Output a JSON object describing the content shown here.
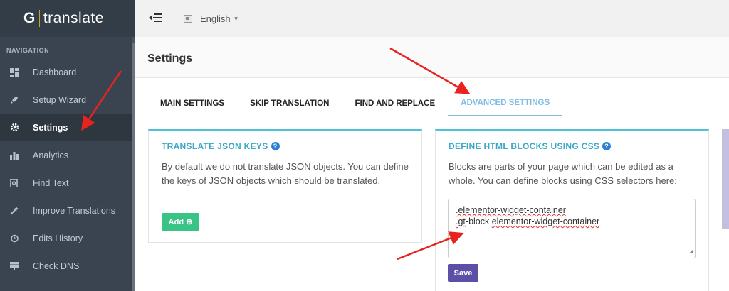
{
  "app": {
    "logo_letter": "G",
    "logo_name": "translate"
  },
  "sidebar": {
    "heading": "NAVIGATION",
    "items": [
      {
        "label": "Dashboard",
        "icon": "dashboard-icon"
      },
      {
        "label": "Setup Wizard",
        "icon": "rocket-icon"
      },
      {
        "label": "Settings",
        "icon": "gear-icon",
        "active": true
      },
      {
        "label": "Analytics",
        "icon": "bar-chart-icon"
      },
      {
        "label": "Find Text",
        "icon": "search-doc-icon"
      },
      {
        "label": "Improve Translations",
        "icon": "wand-icon"
      },
      {
        "label": "Edits History",
        "icon": "history-icon"
      },
      {
        "label": "Check DNS",
        "icon": "server-icon"
      }
    ]
  },
  "topbar": {
    "language": "English"
  },
  "page": {
    "title": "Settings"
  },
  "tabs": [
    {
      "label": "MAIN SETTINGS"
    },
    {
      "label": "SKIP TRANSLATION"
    },
    {
      "label": "FIND AND REPLACE"
    },
    {
      "label": "ADVANCED SETTINGS",
      "active": true
    }
  ],
  "json_panel": {
    "title": "TRANSLATE JSON KEYS",
    "text": "By default we do not translate JSON objects. You can define the keys of JSON objects which should be translated.",
    "add_label": "Add ⊕"
  },
  "css_panel": {
    "title": "DEFINE HTML BLOCKS USING CSS",
    "text": "Blocks are parts of your page which can be edited as a whole. You can define blocks using CSS selectors here:",
    "line1": ".elementor-widget-container",
    "line2_a": ".gt",
    "line2_b": "-block ",
    "line2_c": "elementor-widget-container",
    "save_label": "Save"
  },
  "colors": {
    "sidebar_bg": "#3a4450",
    "accent_tab": "#7cbde6",
    "panel_title": "#3aa8c9",
    "add_button": "#39c486",
    "save_button": "#5b4fa6",
    "arrow": "#e8231f"
  }
}
